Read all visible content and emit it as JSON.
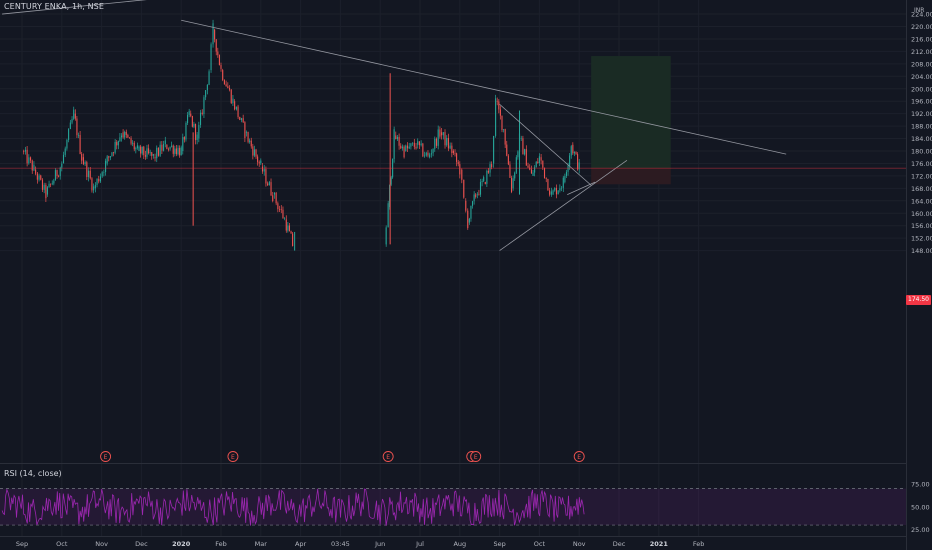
{
  "header": {
    "title": "CENTURY ENKA, 1h, NSE",
    "currency": "INR"
  },
  "rsi_label": "RSI (14, close)",
  "last_price_label": "174.50",
  "earnings_marker": "E",
  "colors": {
    "background": "#131722",
    "up": "#26a69a",
    "down": "#ef5350",
    "rsi_line": "#9c27b0",
    "trendline": "#9598a1",
    "last_price": "#f23645",
    "target_zone": "#1a2b24",
    "stop_zone": "#2c1b21"
  },
  "chart_data": [
    {
      "type": "candlestick",
      "ylim": [
        148,
        224
      ],
      "y_ticks": [
        "148.00",
        "152.00",
        "156.00",
        "160.00",
        "164.00",
        "168.00",
        "172.00",
        "176.00",
        "180.00",
        "184.00",
        "188.00",
        "192.00",
        "196.00",
        "200.00",
        "204.00",
        "208.00",
        "212.00",
        "216.00",
        "220.00",
        "224.00"
      ],
      "x_ticks": [
        "Sep",
        "Oct",
        "Nov",
        "Dec",
        "2020",
        "Feb",
        "Mar",
        "Apr",
        "03:45",
        "Jun",
        "Jul",
        "Aug",
        "Sep",
        "Oct",
        "Nov",
        "Dec",
        "2021",
        "Feb"
      ],
      "last_price": 174.5,
      "price_path": [
        {
          "x": 0,
          "y": 180
        },
        {
          "x": 0.3,
          "y": 174
        },
        {
          "x": 0.6,
          "y": 166
        },
        {
          "x": 1.0,
          "y": 176
        },
        {
          "x": 1.3,
          "y": 192
        },
        {
          "x": 1.5,
          "y": 178
        },
        {
          "x": 1.8,
          "y": 168
        },
        {
          "x": 2.1,
          "y": 176
        },
        {
          "x": 2.5,
          "y": 186
        },
        {
          "x": 2.9,
          "y": 180
        },
        {
          "x": 3.3,
          "y": 178
        },
        {
          "x": 3.6,
          "y": 182
        },
        {
          "x": 4.0,
          "y": 180
        },
        {
          "x": 4.2,
          "y": 192
        },
        {
          "x": 4.4,
          "y": 184
        },
        {
          "x": 4.7,
          "y": 206
        },
        {
          "x": 4.8,
          "y": 219
        },
        {
          "x": 5.0,
          "y": 206
        },
        {
          "x": 5.3,
          "y": 196
        },
        {
          "x": 5.6,
          "y": 186
        },
        {
          "x": 6.0,
          "y": 175
        },
        {
          "x": 6.3,
          "y": 166
        },
        {
          "x": 6.6,
          "y": 158
        },
        {
          "x": 6.8,
          "y": 150
        },
        {
          "x": 9.1,
          "y": 150
        },
        {
          "x": 9.2,
          "y": 162
        },
        {
          "x": 9.35,
          "y": 185
        },
        {
          "x": 9.6,
          "y": 180
        },
        {
          "x": 9.9,
          "y": 182
        },
        {
          "x": 10.2,
          "y": 178
        },
        {
          "x": 10.5,
          "y": 186
        },
        {
          "x": 10.8,
          "y": 180
        },
        {
          "x": 11.0,
          "y": 174
        },
        {
          "x": 11.1,
          "y": 164
        },
        {
          "x": 11.2,
          "y": 157
        },
        {
          "x": 11.4,
          "y": 166
        },
        {
          "x": 11.6,
          "y": 170
        },
        {
          "x": 11.8,
          "y": 176
        },
        {
          "x": 11.9,
          "y": 196
        },
        {
          "x": 12.1,
          "y": 187
        },
        {
          "x": 12.3,
          "y": 168
        },
        {
          "x": 12.5,
          "y": 184
        },
        {
          "x": 12.8,
          "y": 172
        },
        {
          "x": 13.0,
          "y": 178
        },
        {
          "x": 13.3,
          "y": 166
        },
        {
          "x": 13.6,
          "y": 170
        },
        {
          "x": 13.8,
          "y": 182
        },
        {
          "x": 14.0,
          "y": 174.5
        }
      ],
      "spikes": [
        {
          "x": 4.3,
          "low": 156,
          "high": 186
        },
        {
          "x": 6.85,
          "low": 148,
          "high": 154
        },
        {
          "x": 9.25,
          "low": 150,
          "high": 205
        },
        {
          "x": 12.5,
          "low": 166,
          "high": 193
        }
      ],
      "trendlines": [
        {
          "from": {
            "x": -0.5,
            "y": 224
          },
          "to": {
            "x": 4.2,
            "y": 230
          }
        },
        {
          "from": {
            "x": 4.0,
            "y": 222
          },
          "to": {
            "x": 19.2,
            "y": 179
          }
        },
        {
          "from": {
            "x": 12.0,
            "y": 195
          },
          "to": {
            "x": 14.3,
            "y": 169
          }
        },
        {
          "from": {
            "x": 12.0,
            "y": 148
          },
          "to": {
            "x": 15.2,
            "y": 177
          }
        },
        {
          "from": {
            "x": 13.7,
            "y": 166
          },
          "to": {
            "x": 14.4,
            "y": 170
          }
        }
      ],
      "long_position": {
        "x_start": 14.3,
        "x_end": 16.3,
        "entry": 174.5,
        "target": 210.5,
        "stop": 169.3
      },
      "earnings_events": [
        2.1,
        5.3,
        9.2,
        11.3,
        11.4,
        14.0
      ]
    },
    {
      "type": "line",
      "name": "RSI (14, close)",
      "ylim": [
        18,
        86
      ],
      "y_ticks": [
        "25.00",
        "50.00",
        "75.00"
      ],
      "bands": [
        30,
        70
      ],
      "x_range": [
        -0.5,
        14.15
      ],
      "mean": 50,
      "amplitude": 16
    }
  ]
}
